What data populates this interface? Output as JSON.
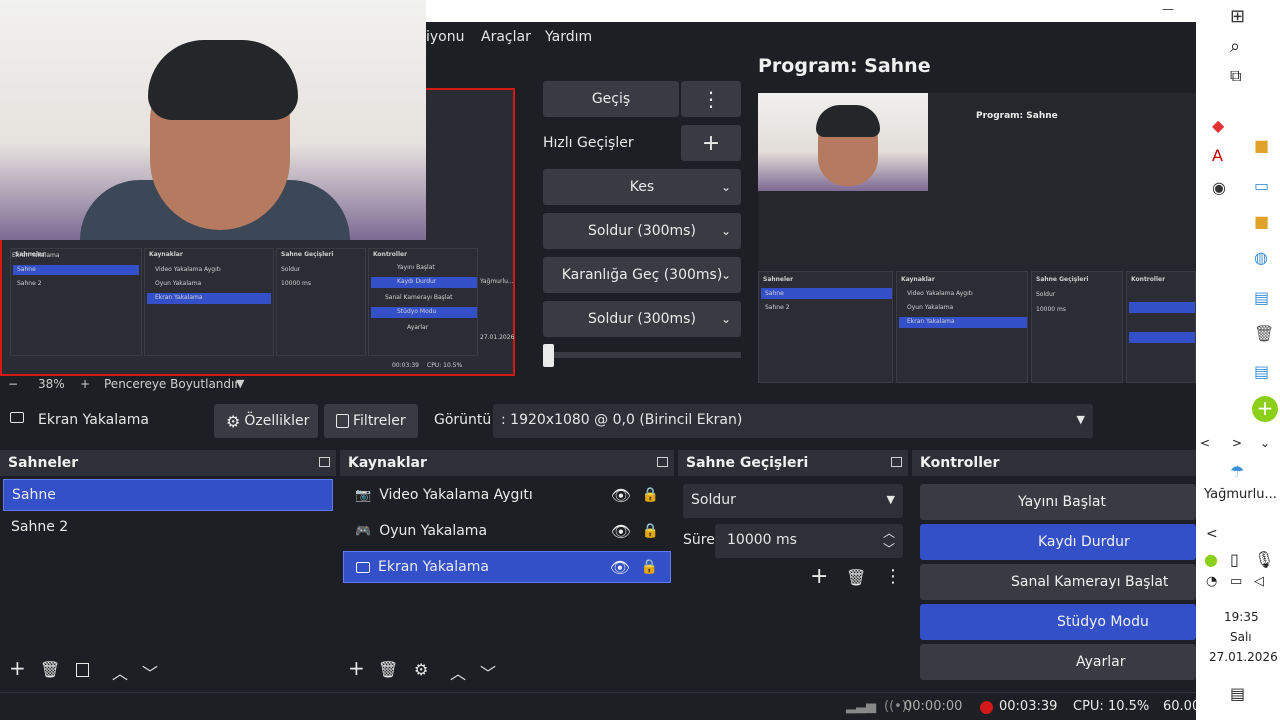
{
  "menu": {
    "items": [
      "iyonu",
      "Araçlar",
      "Yardım"
    ],
    "window_ctrl": "—"
  },
  "preview": {
    "zoom": "38%",
    "fit_label": "Pencereye Boyutlandır"
  },
  "mini_ui": {
    "preview_source": "Ekran Yakalama",
    "preview_props": "Özellikler",
    "preview_filters": "Filtreler",
    "preview_display": "Görüntü",
    "preview_display_val": "1920x1080 @ 0,0 (Birincil Ekran)",
    "scenes_title": "Sahneler",
    "scene1": "Sahne",
    "scene2": "Sahne 2",
    "sources_title": "Kaynaklar",
    "src1": "Video Yakalama Aygıtı",
    "src2": "Oyun Yakalama",
    "src3": "Ekran Yakalama",
    "trans_title": "Sahne Geçişleri",
    "trans_val": "Soldur",
    "trans_dur_label": "Süre",
    "trans_dur": "10000 ms",
    "ctrl_title": "Kontroller",
    "ctrl1": "Yayını Başlat",
    "ctrl2": "Kaydı Durdur",
    "ctrl3": "Sanal Kamerayı Başlat",
    "ctrl4": "Stüdyo Modu",
    "ctrl5": "Ayarlar",
    "status_rec": "00:03:39",
    "status_cpu": "CPU: 10.5%",
    "status_fps": "60.00",
    "program_label": "Program: Sahne",
    "weather": "Yağmurlu...",
    "time": "19:35",
    "day": "Salı",
    "date": "27.01.2026"
  },
  "transitions": {
    "gecis": "Geçiş",
    "quick_label": "Hızlı Geçişler",
    "items": [
      "Kes",
      "Soldur (300ms)",
      "Karanlığa Geç (300ms)",
      "Soldur (300ms)"
    ],
    "slider_fraction": 0.02
  },
  "program": {
    "title": "Program: Sahne"
  },
  "toolbar": {
    "source_name": "Ekran Yakalama",
    "properties": "Özellikler",
    "filters": "Filtreler",
    "display_label": "Görüntü",
    "display_value": ": 1920x1080 @ 0,0 (Birincil Ekran)"
  },
  "scenes": {
    "title": "Sahneler",
    "items": [
      "Sahne",
      "Sahne 2"
    ]
  },
  "sources": {
    "title": "Kaynaklar",
    "items": [
      "Video Yakalama Aygıtı",
      "Oyun Yakalama",
      "Ekran Yakalama"
    ]
  },
  "scene_transitions": {
    "title": "Sahne Geçişleri",
    "type": "Soldur",
    "duration_label": "Süre",
    "duration": "10000 ms"
  },
  "controls": {
    "title": "Kontroller",
    "start_stream": "Yayını Başlat",
    "stop_recording": "Kaydı Durdur",
    "start_virtualcam": "Sanal Kamerayı Başlat",
    "studio_mode": "Stüdyo Modu",
    "settings": "Ayarlar"
  },
  "status": {
    "stream_time": "00:00:00",
    "rec_time": "00:03:39",
    "cpu": "CPU: 10.5%",
    "fps": "60.00"
  },
  "taskbar": {
    "weather": "Yağmurlu...",
    "time": "19:35",
    "day": "Salı",
    "date": "27.01.2026"
  },
  "colors": {
    "accent": "#3450c8",
    "record": "#d31818",
    "panel": "#272830",
    "bg": "#1e1f24"
  }
}
